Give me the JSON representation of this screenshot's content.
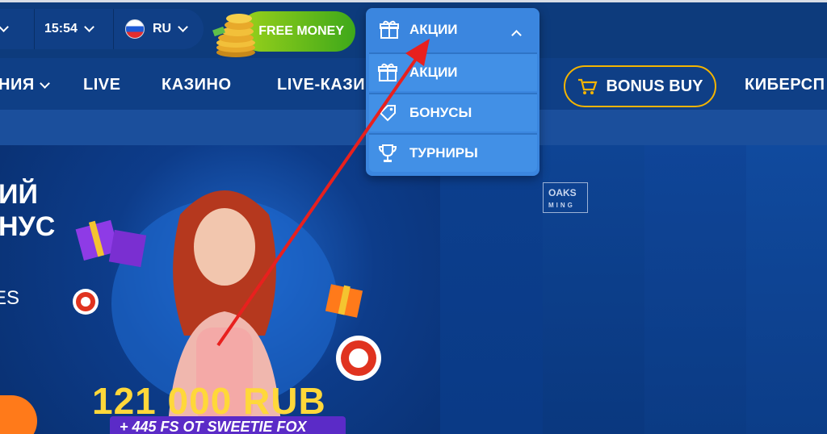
{
  "topbar": {
    "time": "15:54",
    "language": "RU",
    "free_money_label": "FREE MONEY"
  },
  "nav": {
    "items": [
      {
        "label": "НИЯ"
      },
      {
        "label": "LIVE"
      },
      {
        "label": "КАЗИНО"
      },
      {
        "label": "LIVE-КАЗИ"
      },
      {
        "label": "КИБЕРСП"
      }
    ],
    "bonus_buy_label": "BONUS BUY"
  },
  "dropdown": {
    "header_label": "АКЦИИ",
    "items": [
      {
        "label": "АКЦИИ",
        "icon": "gift-icon"
      },
      {
        "label": "БОНУСЫ",
        "icon": "tag-icon"
      },
      {
        "label": "ТУРНИРЫ",
        "icon": "trophy-icon"
      }
    ]
  },
  "hero": {
    "title_line1": "ИЙ",
    "title_line2": "НУС",
    "subtitle": "ES",
    "amount": "121 000 RUB",
    "fs_label": "+ 445 FS ОТ SWEETIE FOX",
    "provider_badge_line1": "OAKS",
    "provider_badge_line2": "MING"
  },
  "colors": {
    "background": "#0b3a7a",
    "accent_blue": "#3b86df",
    "free_money_green": "#6cc21a",
    "bonus_buy_border": "#f4b400",
    "amount_yellow": "#ffd83a",
    "annotation_arrow": "#e8201e"
  }
}
